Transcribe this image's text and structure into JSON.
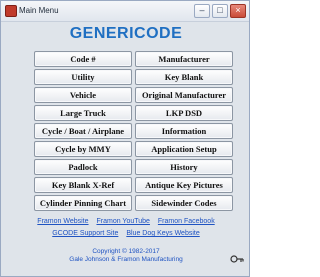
{
  "window": {
    "title": "Main Menu"
  },
  "app_title": "GENERICODE",
  "buttons_left": [
    "Code #",
    "Utility",
    "Vehicle",
    "Large Truck",
    "Cycle / Boat / Airplane",
    "Cycle by MMY",
    "Padlock",
    "Key Blank X-Ref",
    "Cylinder Pinning Chart"
  ],
  "buttons_right": [
    "Manufacturer",
    "Key Blank",
    "Original Manufacturer",
    "LKP DSD",
    "Information",
    "Application Setup",
    "History",
    "Antique Key Pictures",
    "Sidewinder Codes"
  ],
  "links_row1": [
    "Framon Website",
    "Framon YouTube",
    "Framon Facebook"
  ],
  "links_row2": [
    "GCODE Support Site",
    "Blue Dog Keys Website"
  ],
  "copyright": {
    "line1": "Copyright © 1982-2017",
    "line2": "Gale Johnson & Framon Manufacturing"
  },
  "colors": {
    "title": "#1f6fc2",
    "links": "#1f53c2",
    "background": "#dfe4ea"
  }
}
